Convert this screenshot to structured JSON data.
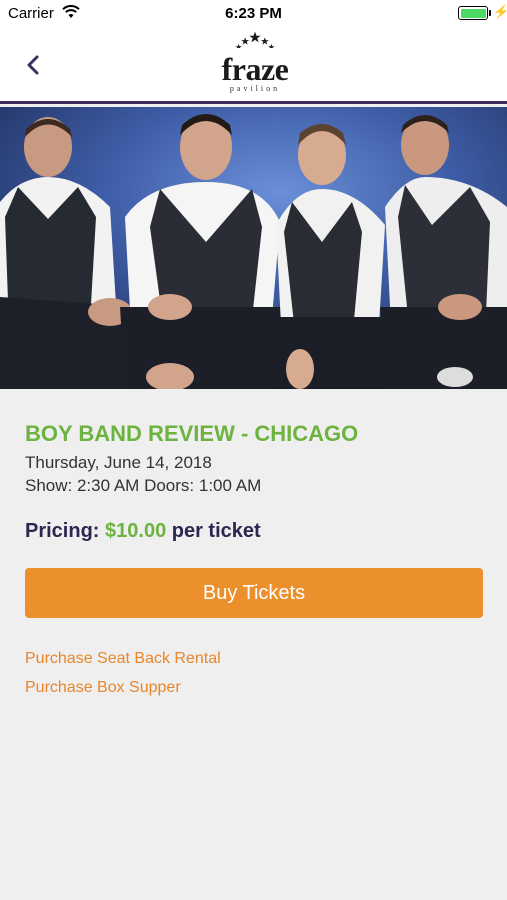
{
  "status_bar": {
    "carrier": "Carrier",
    "time": "6:23 PM",
    "battery_level": 1.0
  },
  "nav": {
    "back_icon": "chevron-left-icon",
    "logo_text": "fraze",
    "logo_subtext": "pavilion"
  },
  "event": {
    "title": "BOY BAND REVIEW - CHICAGO",
    "date": "Thursday, June 14, 2018",
    "showtimes": "Show: 2:30 AM Doors: 1:00 AM",
    "pricing_label": "Pricing:",
    "price": "$10.00",
    "price_suffix": "per ticket"
  },
  "actions": {
    "buy_label": "Buy Tickets",
    "seat_back_label": "Purchase Seat Back Rental",
    "box_supper_label": "Purchase Box Supper"
  },
  "colors": {
    "accent_green": "#6cb33f",
    "accent_orange": "#ec8f2d",
    "link_orange": "#e8862a",
    "brand_purple": "#2d2750"
  }
}
